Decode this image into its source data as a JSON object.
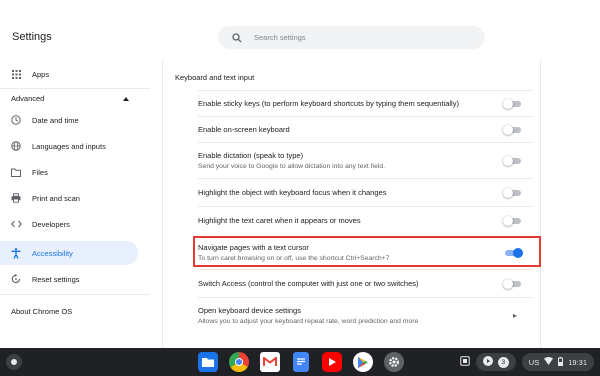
{
  "window": {
    "minimize": "–",
    "maximize": "▢",
    "close": "✕"
  },
  "header": {
    "title": "Settings",
    "search_placeholder": "Search settings"
  },
  "sidebar": {
    "apps": "Apps",
    "advanced": "Advanced",
    "items": [
      {
        "label": "Date and time",
        "icon": "clock-icon"
      },
      {
        "label": "Languages and inputs",
        "icon": "globe-icon"
      },
      {
        "label": "Files",
        "icon": "folder-icon"
      },
      {
        "label": "Print and scan",
        "icon": "printer-icon"
      },
      {
        "label": "Developers",
        "icon": "code-icon"
      },
      {
        "label": "Accessibility",
        "icon": "accessibility-icon"
      },
      {
        "label": "Reset settings",
        "icon": "reset-icon"
      }
    ],
    "about": "About Chrome OS"
  },
  "main": {
    "section_title": "Keyboard and text input",
    "rows": [
      {
        "label": "Enable sticky keys (to perform keyboard shortcuts by typing them sequentially)",
        "enabled": false
      },
      {
        "label": "Enable on-screen keyboard",
        "enabled": false
      },
      {
        "label": "Enable dictation (speak to type)",
        "sub": "Send your voice to Google to allow dictation into any text field.",
        "enabled": false
      },
      {
        "label": "Highlight the object with keyboard focus when it changes",
        "enabled": false
      },
      {
        "label": "Highlight the text caret when it appears or moves",
        "enabled": false
      },
      {
        "label": "Navigate pages with a text cursor",
        "sub": "To turn caret browsing on or off, use the shortcut Ctrl+Search+7",
        "enabled": true
      },
      {
        "label": "Switch Access (control the computer with just one or two switches)",
        "enabled": false
      },
      {
        "label": "Open keyboard device settings",
        "sub": "Allows you to adjust your keyboard repeat rate, word prediction and more"
      }
    ]
  },
  "shelf": {
    "apps": [
      "files-app-icon",
      "chrome-icon",
      "gmail-icon",
      "docs-icon",
      "youtube-icon",
      "play-store-icon",
      "settings-app-icon"
    ],
    "notification_count": "3",
    "locale": "US",
    "time": "19:31"
  },
  "colors": {
    "accent": "#1a73e8",
    "highlight": "#e53935",
    "shelf": "#202124"
  }
}
